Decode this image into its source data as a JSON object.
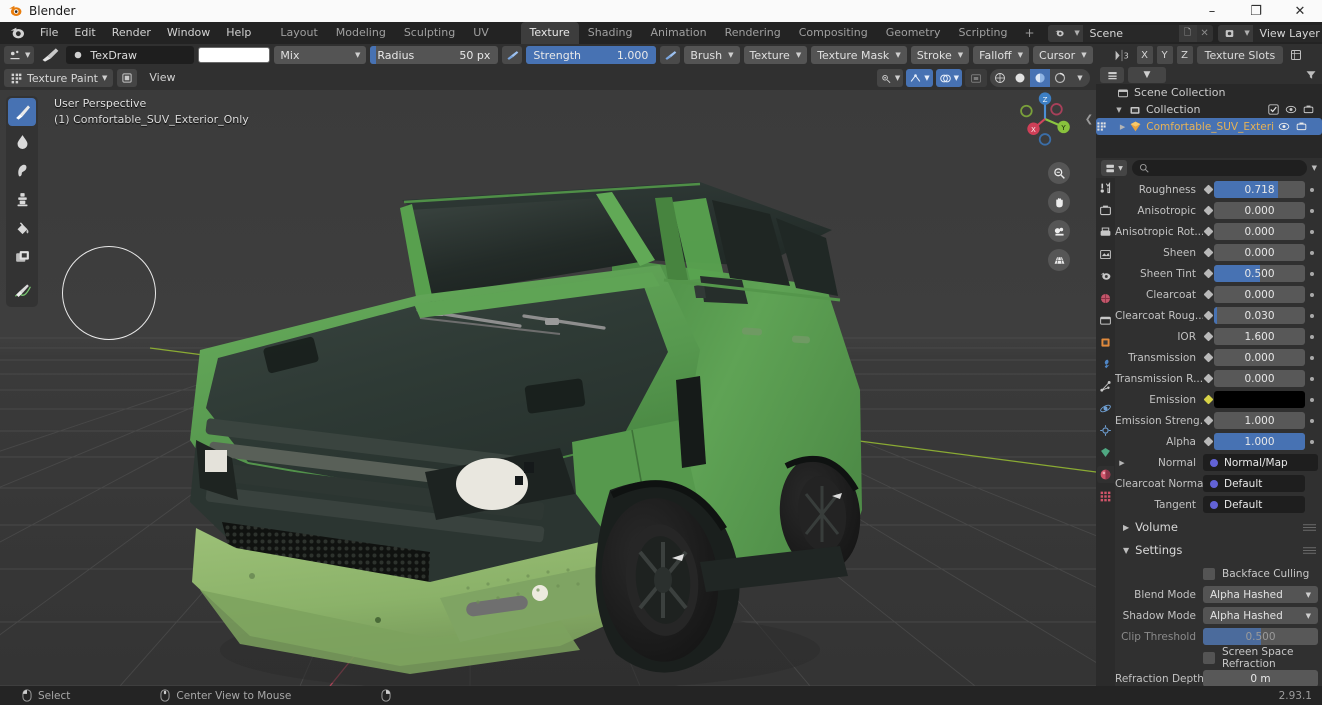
{
  "window": {
    "app_title": "Blender",
    "minimize": "–",
    "maximize": "❐",
    "close": "✕"
  },
  "topbar": {
    "menus": [
      "File",
      "Edit",
      "Render",
      "Window",
      "Help"
    ],
    "workspaces": [
      {
        "label": "Layout",
        "active": false
      },
      {
        "label": "Modeling",
        "active": false
      },
      {
        "label": "Sculpting",
        "active": false
      },
      {
        "label": "UV Editing",
        "active": false
      },
      {
        "label": "Texture Paint",
        "active": true
      },
      {
        "label": "Shading",
        "active": false
      },
      {
        "label": "Animation",
        "active": false
      },
      {
        "label": "Rendering",
        "active": false
      },
      {
        "label": "Compositing",
        "active": false
      },
      {
        "label": "Geometry Nodes",
        "active": false
      },
      {
        "label": "Scripting",
        "active": false
      }
    ],
    "add_workspace": "+",
    "scene_name": "Scene",
    "view_layer_name": "View Layer"
  },
  "tool_settings": {
    "brush_name": "TexDraw",
    "blend_mode": "Mix",
    "radius_label": "Radius",
    "radius_value": "50 px",
    "strength_label": "Strength",
    "strength_value": "1.000",
    "menus": [
      "Brush",
      "Texture",
      "Texture Mask",
      "Stroke",
      "Falloff",
      "Cursor"
    ],
    "axis_x": "X",
    "axis_y": "Y",
    "axis_z": "Z",
    "texture_slots": "Texture Slots"
  },
  "viewport": {
    "mode": "Texture Paint",
    "view_menu": "View",
    "overlay_line1": "User Perspective",
    "overlay_line2": "(1) Comfortable_SUV_Exterior_Only",
    "gizmo_axes": {
      "x": "X",
      "y": "Y",
      "z": "Z"
    },
    "tools": [
      {
        "name": "draw-brush-tool",
        "active": true
      },
      {
        "name": "soften-tool",
        "active": false
      },
      {
        "name": "smear-tool",
        "active": false
      },
      {
        "name": "clone-tool",
        "active": false
      },
      {
        "name": "fill-tool",
        "active": false
      },
      {
        "name": "mask-tool",
        "active": false
      },
      {
        "name": "annotate-tool",
        "active": false
      }
    ],
    "nav_buttons": [
      "zoom-icon",
      "pan-hand-icon",
      "camera-icon",
      "perspective-grid-icon"
    ],
    "colors": {
      "background": "#3c3c3c",
      "grid": "#4b4b4b",
      "axis_x_line": "#a83f52",
      "axis_y_line": "#94b33a",
      "body_green": "#5b9e52",
      "bumper_green": "#8fb66a",
      "dark_panel": "#32403b",
      "tire_black": "#1c1c1c",
      "headlight": "#e8e6df"
    }
  },
  "outliner": {
    "rows": [
      {
        "label": "Scene Collection",
        "indent": 0,
        "icon": "scene-collection-icon",
        "selected": false,
        "has_toggles": false,
        "has_triangle": false
      },
      {
        "label": "Collection",
        "indent": 1,
        "icon": "collection-icon",
        "selected": false,
        "has_toggles": true,
        "has_triangle": true,
        "has_checkbox": true
      },
      {
        "label": "Comfortable_SUV_Exteri",
        "indent": 2,
        "icon": "mesh-object-icon",
        "selected": true,
        "has_toggles": true,
        "has_triangle": true,
        "has_checkbox": false
      }
    ]
  },
  "properties": {
    "search_placeholder": "",
    "tabs": [
      {
        "name": "tool-tab",
        "active": true
      },
      {
        "name": "render-tab",
        "active": false
      },
      {
        "name": "output-tab",
        "active": false
      },
      {
        "name": "view-layer-tab",
        "active": false
      },
      {
        "name": "scene-tab",
        "active": false
      },
      {
        "name": "world-tab",
        "active": false
      },
      {
        "name": "collection-tab",
        "active": false
      },
      {
        "name": "object-tab",
        "active": false
      },
      {
        "name": "modifiers-tab",
        "active": false
      },
      {
        "name": "particles-tab",
        "active": false
      },
      {
        "name": "physics-tab",
        "active": false
      },
      {
        "name": "constraints-tab",
        "active": false
      },
      {
        "name": "object-data-tab",
        "active": false
      },
      {
        "name": "material-tab",
        "active": true
      },
      {
        "name": "texture-tab",
        "active": false
      }
    ],
    "fields": [
      {
        "label": "Roughness",
        "value": "0.718",
        "fill": 70,
        "type": "slider"
      },
      {
        "label": "Anisotropic",
        "value": "0.000",
        "fill": 0,
        "type": "slider"
      },
      {
        "label": "Anisotropic Rot...",
        "value": "0.000",
        "fill": 0,
        "type": "slider"
      },
      {
        "label": "Sheen",
        "value": "0.000",
        "fill": 0,
        "type": "slider"
      },
      {
        "label": "Sheen Tint",
        "value": "0.500",
        "fill": 50,
        "type": "slider"
      },
      {
        "label": "Clearcoat",
        "value": "0.000",
        "fill": 0,
        "type": "slider"
      },
      {
        "label": "Clearcoat Roug...",
        "value": "0.030",
        "fill": 3,
        "type": "slider"
      },
      {
        "label": "IOR",
        "value": "1.600",
        "fill": 0,
        "type": "slider"
      },
      {
        "label": "Transmission",
        "value": "0.000",
        "fill": 0,
        "type": "slider"
      },
      {
        "label": "Transmission R...",
        "value": "0.000",
        "fill": 0,
        "type": "slider"
      },
      {
        "label": "Emission",
        "value": "",
        "fill": 0,
        "type": "color",
        "color": "#000000"
      },
      {
        "label": "Emission Streng...",
        "value": "1.000",
        "fill": 0,
        "type": "slider"
      },
      {
        "label": "Alpha",
        "value": "1.000",
        "fill": 100,
        "type": "slider"
      },
      {
        "label": "Normal",
        "value": "Normal/Map",
        "type": "socket",
        "expandable": true
      },
      {
        "label": "Clearcoat Normal",
        "value": "Default",
        "type": "socket"
      },
      {
        "label": "Tangent",
        "value": "Default",
        "type": "socket"
      }
    ],
    "volume_panel": "Volume",
    "settings_panel": "Settings",
    "settings": {
      "backface_culling": "Backface Culling",
      "blend_mode_label": "Blend Mode",
      "blend_mode_value": "Alpha Hashed",
      "shadow_mode_label": "Shadow Mode",
      "shadow_mode_value": "Alpha Hashed",
      "clip_threshold_label": "Clip Threshold",
      "clip_threshold_value": "0.500",
      "screen_space_refraction": "Screen Space Refraction",
      "refraction_depth_label": "Refraction Depth",
      "refraction_depth_value": "0 m"
    }
  },
  "statusbar": {
    "items": [
      {
        "label": "Select",
        "icon": "mouse-left-icon"
      },
      {
        "label": "Center View to Mouse",
        "icon": "mouse-middle-icon"
      },
      {
        "label": "",
        "icon": "mouse-right-icon"
      }
    ],
    "version": "2.93.1"
  }
}
